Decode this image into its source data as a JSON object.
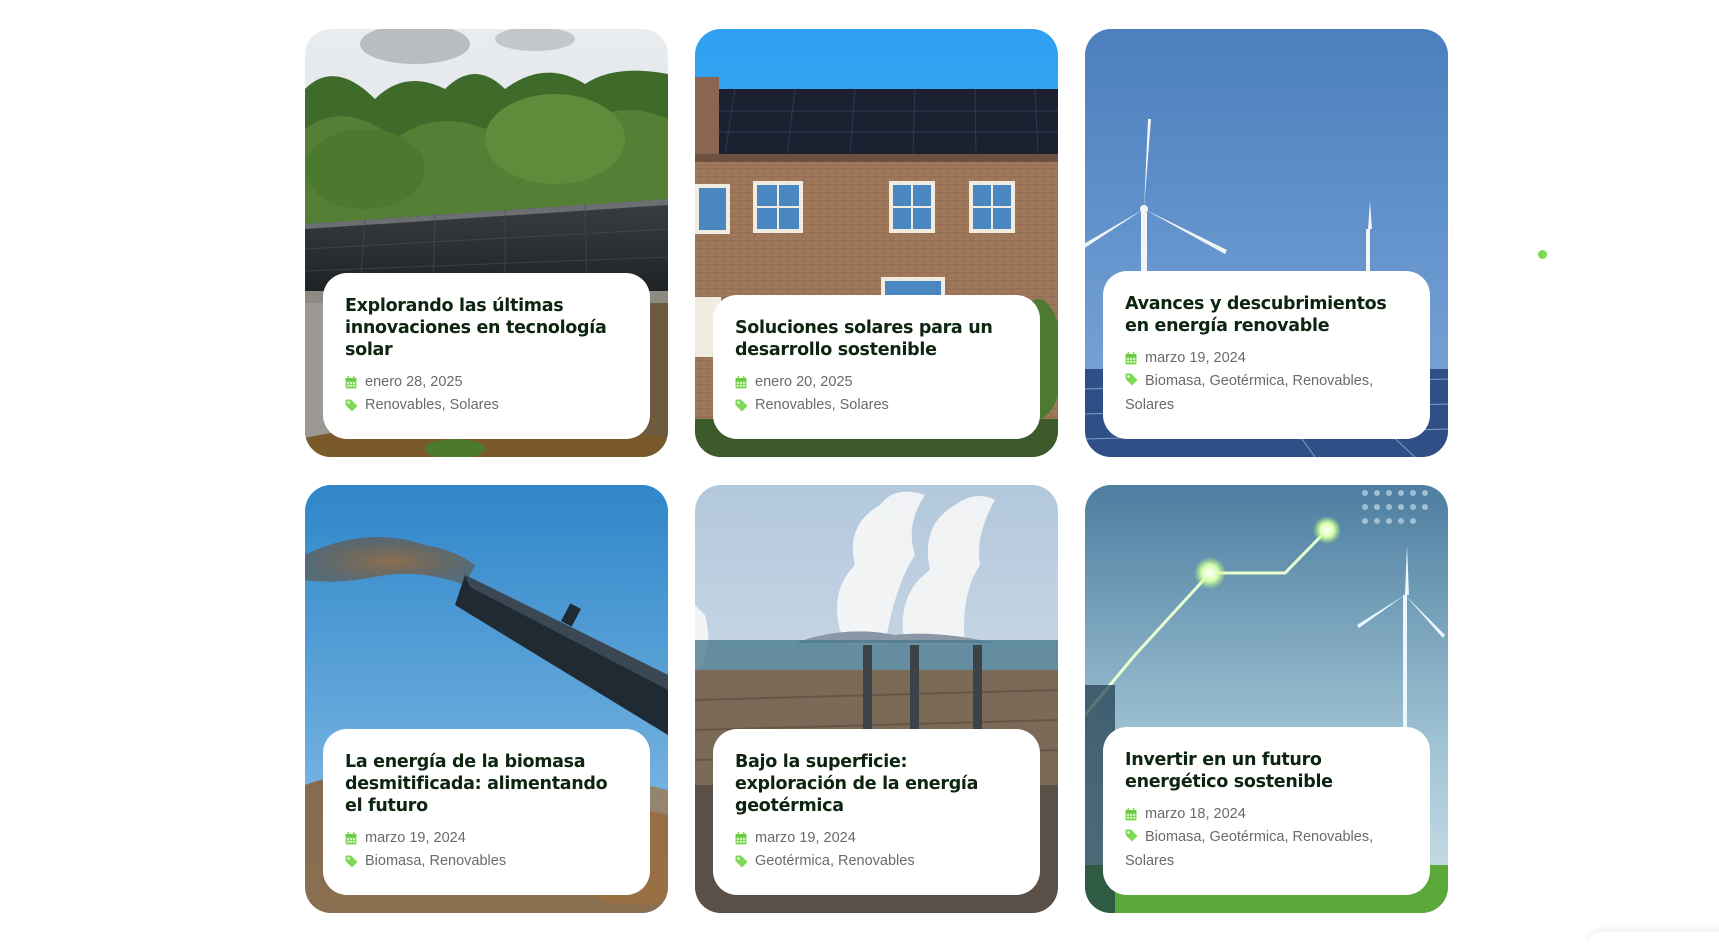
{
  "colors": {
    "accent": "#7ed957",
    "title": "#0c2410",
    "meta": "#6a6a6a"
  },
  "posts": [
    {
      "title": "Explorando las últimas innovaciones en tecnología solar",
      "date": "enero 28, 2025",
      "categories": [
        "Renovables",
        "Solares"
      ],
      "image": "solar-roof-forest"
    },
    {
      "title": "Soluciones solares para un desarrollo sostenible",
      "date": "enero 20, 2025",
      "categories": [
        "Renovables",
        "Solares"
      ],
      "image": "solar-roof-brick-house"
    },
    {
      "title": "Avances y descubrimientos en energía renovable",
      "date": "marzo 19, 2024",
      "categories": [
        "Biomasa",
        "Geotérmica",
        "Renovables",
        "Solares"
      ],
      "image": "wind-turbines-sky"
    },
    {
      "title": "La energía de la biomasa desmitificada: alimentando el futuro",
      "date": "marzo 19, 2024",
      "categories": [
        "Biomasa",
        "Renovables"
      ],
      "image": "biomass-conveyor"
    },
    {
      "title": "Bajo la superficie: exploración de la energía geotérmica",
      "date": "marzo 19, 2024",
      "categories": [
        "Geotérmica",
        "Renovables"
      ],
      "image": "geothermal-plant"
    },
    {
      "title": "Invertir en un futuro energético sostenible",
      "date": "marzo 18, 2024",
      "categories": [
        "Biomasa",
        "Geotérmica",
        "Renovables",
        "Solares"
      ],
      "image": "digital-wind-growth"
    }
  ]
}
